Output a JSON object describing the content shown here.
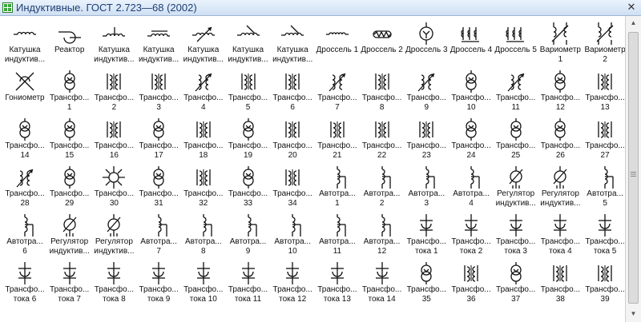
{
  "window": {
    "title": "Индуктивные. ГОСТ 2.723—68 (2002)",
    "close_glyph": "✕"
  },
  "stencil": {
    "rows": [
      [
        {
          "label": "Катушка\nиндуктив...",
          "icon": "coil-icon"
        },
        {
          "label": "Реактор",
          "icon": "reactor-icon"
        },
        {
          "label": "Катушка\nиндуктив...",
          "icon": "coil-tap-icon"
        },
        {
          "label": "Катушка\nиндуктив...",
          "icon": "coil-core-icon"
        },
        {
          "label": "Катушка\nиндуктив...",
          "icon": "coil-variable-icon"
        },
        {
          "label": "Катушка\nиндуктив...",
          "icon": "coil-adjustable-icon"
        },
        {
          "label": "Катушка\nиндуктив...",
          "icon": "coil-adjustable-icon"
        },
        {
          "label": "Дроссель 1",
          "icon": "choke-icon"
        },
        {
          "label": "Дроссель 2",
          "icon": "choke-core-icon"
        },
        {
          "label": "Дроссель 3",
          "icon": "choke-circle-icon"
        },
        {
          "label": "Дроссель 4",
          "icon": "choke-winding-icon"
        },
        {
          "label": "Дроссель 5",
          "icon": "choke-winding-icon"
        },
        {
          "label": "Вариометр\n1",
          "icon": "variometer-icon"
        },
        {
          "label": "Вариометр\n2",
          "icon": "variometer-icon"
        }
      ],
      [
        {
          "label": "Гониометр",
          "icon": "goniometer-icon"
        },
        {
          "label": "Трансфо...\n1",
          "icon": "transformer-circles-icon"
        },
        {
          "label": "Трансфо...\n2",
          "icon": "transformer-windings-icon"
        },
        {
          "label": "Трансфо...\n3",
          "icon": "transformer-windings-icon"
        },
        {
          "label": "Трансфо...\n4",
          "icon": "transformer-adjustable-icon"
        },
        {
          "label": "Трансфо...\n5",
          "icon": "transformer-windings-icon"
        },
        {
          "label": "Трансфо...\n6",
          "icon": "transformer-windings-icon"
        },
        {
          "label": "Трансфо...\n7",
          "icon": "transformer-adjustable-icon"
        },
        {
          "label": "Трансфо...\n8",
          "icon": "transformer-windings-icon"
        },
        {
          "label": "Трансфо...\n9",
          "icon": "transformer-adjustable-icon"
        },
        {
          "label": "Трансфо...\n10",
          "icon": "transformer-circles-icon"
        },
        {
          "label": "Трансфо...\n11",
          "icon": "transformer-adjustable-icon"
        },
        {
          "label": "Трансфо...\n12",
          "icon": "transformer-circles-icon"
        },
        {
          "label": "Трансфо...\n13",
          "icon": "transformer-windings-icon"
        }
      ],
      [
        {
          "label": "Трансфо...\n14",
          "icon": "transformer-circles-icon"
        },
        {
          "label": "Трансфо...\n15",
          "icon": "transformer-circles-icon"
        },
        {
          "label": "Трансфо...\n16",
          "icon": "transformer-windings-icon"
        },
        {
          "label": "Трансфо...\n17",
          "icon": "transformer-circles-icon"
        },
        {
          "label": "Трансфо...\n18",
          "icon": "transformer-windings-icon"
        },
        {
          "label": "Трансфо...\n19",
          "icon": "transformer-circles-icon"
        },
        {
          "label": "Трансфо...\n20",
          "icon": "transformer-windings-icon"
        },
        {
          "label": "Трансфо...\n21",
          "icon": "transformer-windings-icon"
        },
        {
          "label": "Трансфо...\n22",
          "icon": "transformer-windings-icon"
        },
        {
          "label": "Трансфо...\n23",
          "icon": "transformer-windings-icon"
        },
        {
          "label": "Трансфо...\n24",
          "icon": "transformer-circles-icon"
        },
        {
          "label": "Трансфо...\n25",
          "icon": "transformer-circles-icon"
        },
        {
          "label": "Трансфо...\n26",
          "icon": "transformer-circles-icon"
        },
        {
          "label": "Трансфо...\n27",
          "icon": "transformer-windings-icon"
        }
      ],
      [
        {
          "label": "Трансфо...\n28",
          "icon": "transformer-adjustable-icon"
        },
        {
          "label": "Трансфо...\n29",
          "icon": "transformer-circles-icon"
        },
        {
          "label": "Трансфо...\n30",
          "icon": "star-transformer-icon"
        },
        {
          "label": "Трансфо...\n31",
          "icon": "transformer-circles-icon"
        },
        {
          "label": "Трансфо...\n32",
          "icon": "transformer-windings-icon"
        },
        {
          "label": "Трансфо...\n33",
          "icon": "transformer-circles-icon"
        },
        {
          "label": "Трансфо...\n34",
          "icon": "transformer-windings-icon"
        },
        {
          "label": "Автотра...\n1",
          "icon": "autotransformer-icon"
        },
        {
          "label": "Автотра...\n2",
          "icon": "autotransformer-icon"
        },
        {
          "label": "Автотра...\n3",
          "icon": "autotransformer-icon"
        },
        {
          "label": "Автотра...\n4",
          "icon": "autotransformer-icon"
        },
        {
          "label": "Регулятор\nиндуктив...",
          "icon": "regulator-icon"
        },
        {
          "label": "Регулятор\nиндуктив...",
          "icon": "regulator-icon"
        },
        {
          "label": "Автотра...\n5",
          "icon": "autotransformer-icon"
        }
      ],
      [
        {
          "label": "Автотра...\n6",
          "icon": "autotransformer-icon"
        },
        {
          "label": "Регулятор\nиндуктив...",
          "icon": "regulator-icon"
        },
        {
          "label": "Регулятор\nиндуктив...",
          "icon": "regulator-icon"
        },
        {
          "label": "Автотра...\n7",
          "icon": "autotransformer-icon"
        },
        {
          "label": "Автотра...\n8",
          "icon": "autotransformer-icon"
        },
        {
          "label": "Автотра...\n9",
          "icon": "autotransformer-icon"
        },
        {
          "label": "Автотра...\n10",
          "icon": "autotransformer-icon"
        },
        {
          "label": "Автотра...\n11",
          "icon": "autotransformer-icon"
        },
        {
          "label": "Автотра...\n12",
          "icon": "autotransformer-icon"
        },
        {
          "label": "Трансфо...\nтока 1",
          "icon": "current-transformer-icon"
        },
        {
          "label": "Трансфо...\nтока 2",
          "icon": "current-transformer-icon"
        },
        {
          "label": "Трансфо...\nтока 3",
          "icon": "current-transformer-icon"
        },
        {
          "label": "Трансфо...\nтока 4",
          "icon": "current-transformer-icon"
        },
        {
          "label": "Трансфо...\nтока 5",
          "icon": "current-transformer-icon"
        }
      ],
      [
        {
          "label": "Трансфо...\nтока 6",
          "icon": "current-transformer-icon"
        },
        {
          "label": "Трансфо...\nтока 7",
          "icon": "current-transformer-icon"
        },
        {
          "label": "Трансфо...\nтока 8",
          "icon": "current-transformer-icon"
        },
        {
          "label": "Трансфо...\nтока 9",
          "icon": "current-transformer-icon"
        },
        {
          "label": "Трансфо...\nтока 10",
          "icon": "current-transformer-icon"
        },
        {
          "label": "Трансфо...\nтока 11",
          "icon": "current-transformer-icon"
        },
        {
          "label": "Трансфо...\nтока 12",
          "icon": "current-transformer-icon"
        },
        {
          "label": "Трансфо...\nтока 13",
          "icon": "current-transformer-icon"
        },
        {
          "label": "Трансфо...\nтока 14",
          "icon": "current-transformer-icon"
        },
        {
          "label": "Трансфо...\n35",
          "icon": "transformer-circles-icon"
        },
        {
          "label": "Трансфо...\n36",
          "icon": "transformer-windings-icon"
        },
        {
          "label": "Трансфо...\n37",
          "icon": "transformer-circles-icon"
        },
        {
          "label": "Трансфо...\n38",
          "icon": "transformer-windings-icon"
        },
        {
          "label": "Трансфо...\n39",
          "icon": "transformer-windings-icon"
        }
      ]
    ]
  }
}
